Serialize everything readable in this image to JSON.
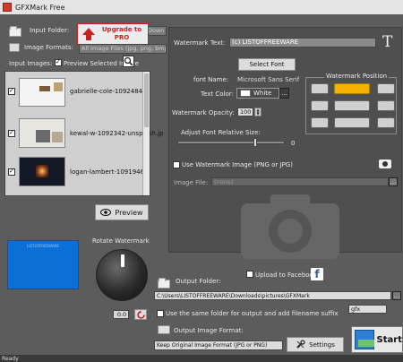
{
  "window": {
    "title": "GFXMark Free"
  },
  "left": {
    "input_folder_label": "Input Folder:",
    "input_folder_value": "Down",
    "upgrade_line1": "Upgrade to",
    "upgrade_line2": "PRO",
    "image_formats_label": "Image Formats:",
    "image_formats_value": "All Image Files (jpg, png, bmp, tif",
    "input_images_label": "Input Images:",
    "preview_selected_label": "Preview Selected Image",
    "images": [
      {
        "name": "gabrielle-cole-1092484-u"
      },
      {
        "name": "kewal-w-1092342-unsplash.jp"
      },
      {
        "name": "logan-lambert-1091946-"
      }
    ],
    "preview_button": "Preview",
    "rotate_label": "Rotate Watermark",
    "rotate_value": "0.0",
    "preview_watermark_text": "LISTOFFREEWARE"
  },
  "right": {
    "watermark_text_label": "Watermark Text:",
    "watermark_text_value": "(c) LISTOFFREEWARE",
    "select_font": "Select Font",
    "font_name_label": "font Name:",
    "font_name_value": "Microsoft Sans Serif",
    "text_color_label": "Text Color:",
    "text_color_value": "White",
    "watermark_position_label": "Watermark Position",
    "opacity_label": "Watermark Opacity:",
    "opacity_value": "100",
    "relative_size_label": "Adjust Font Relative Size:",
    "relative_size_value": "0",
    "use_image_label": "Use Watermark Image (PNG or JPG)",
    "image_file_label": "Image File:",
    "image_file_value": "(none)",
    "output_folder_label": "Output Folder:",
    "upload_facebook_label": "Upload to Facebook",
    "output_folder_value": "C:\\Users\\LISTOFFREEWARE\\Downloads\\pictures\\GFXMark",
    "same_folder_label": "Use the same folder for output and add filename suffix",
    "suffix_value": "gfx",
    "output_format_label": "Output Image Format:",
    "output_format_value": "Keep Original Image Format (JPG or PNG)",
    "settings_button": "Settings",
    "start_button": "Start"
  },
  "status": {
    "text": "Ready"
  },
  "colors": {
    "accent": "#f5b300",
    "upgrade_red": "#cc1f1f",
    "preview_blue": "#0a6fd6"
  }
}
